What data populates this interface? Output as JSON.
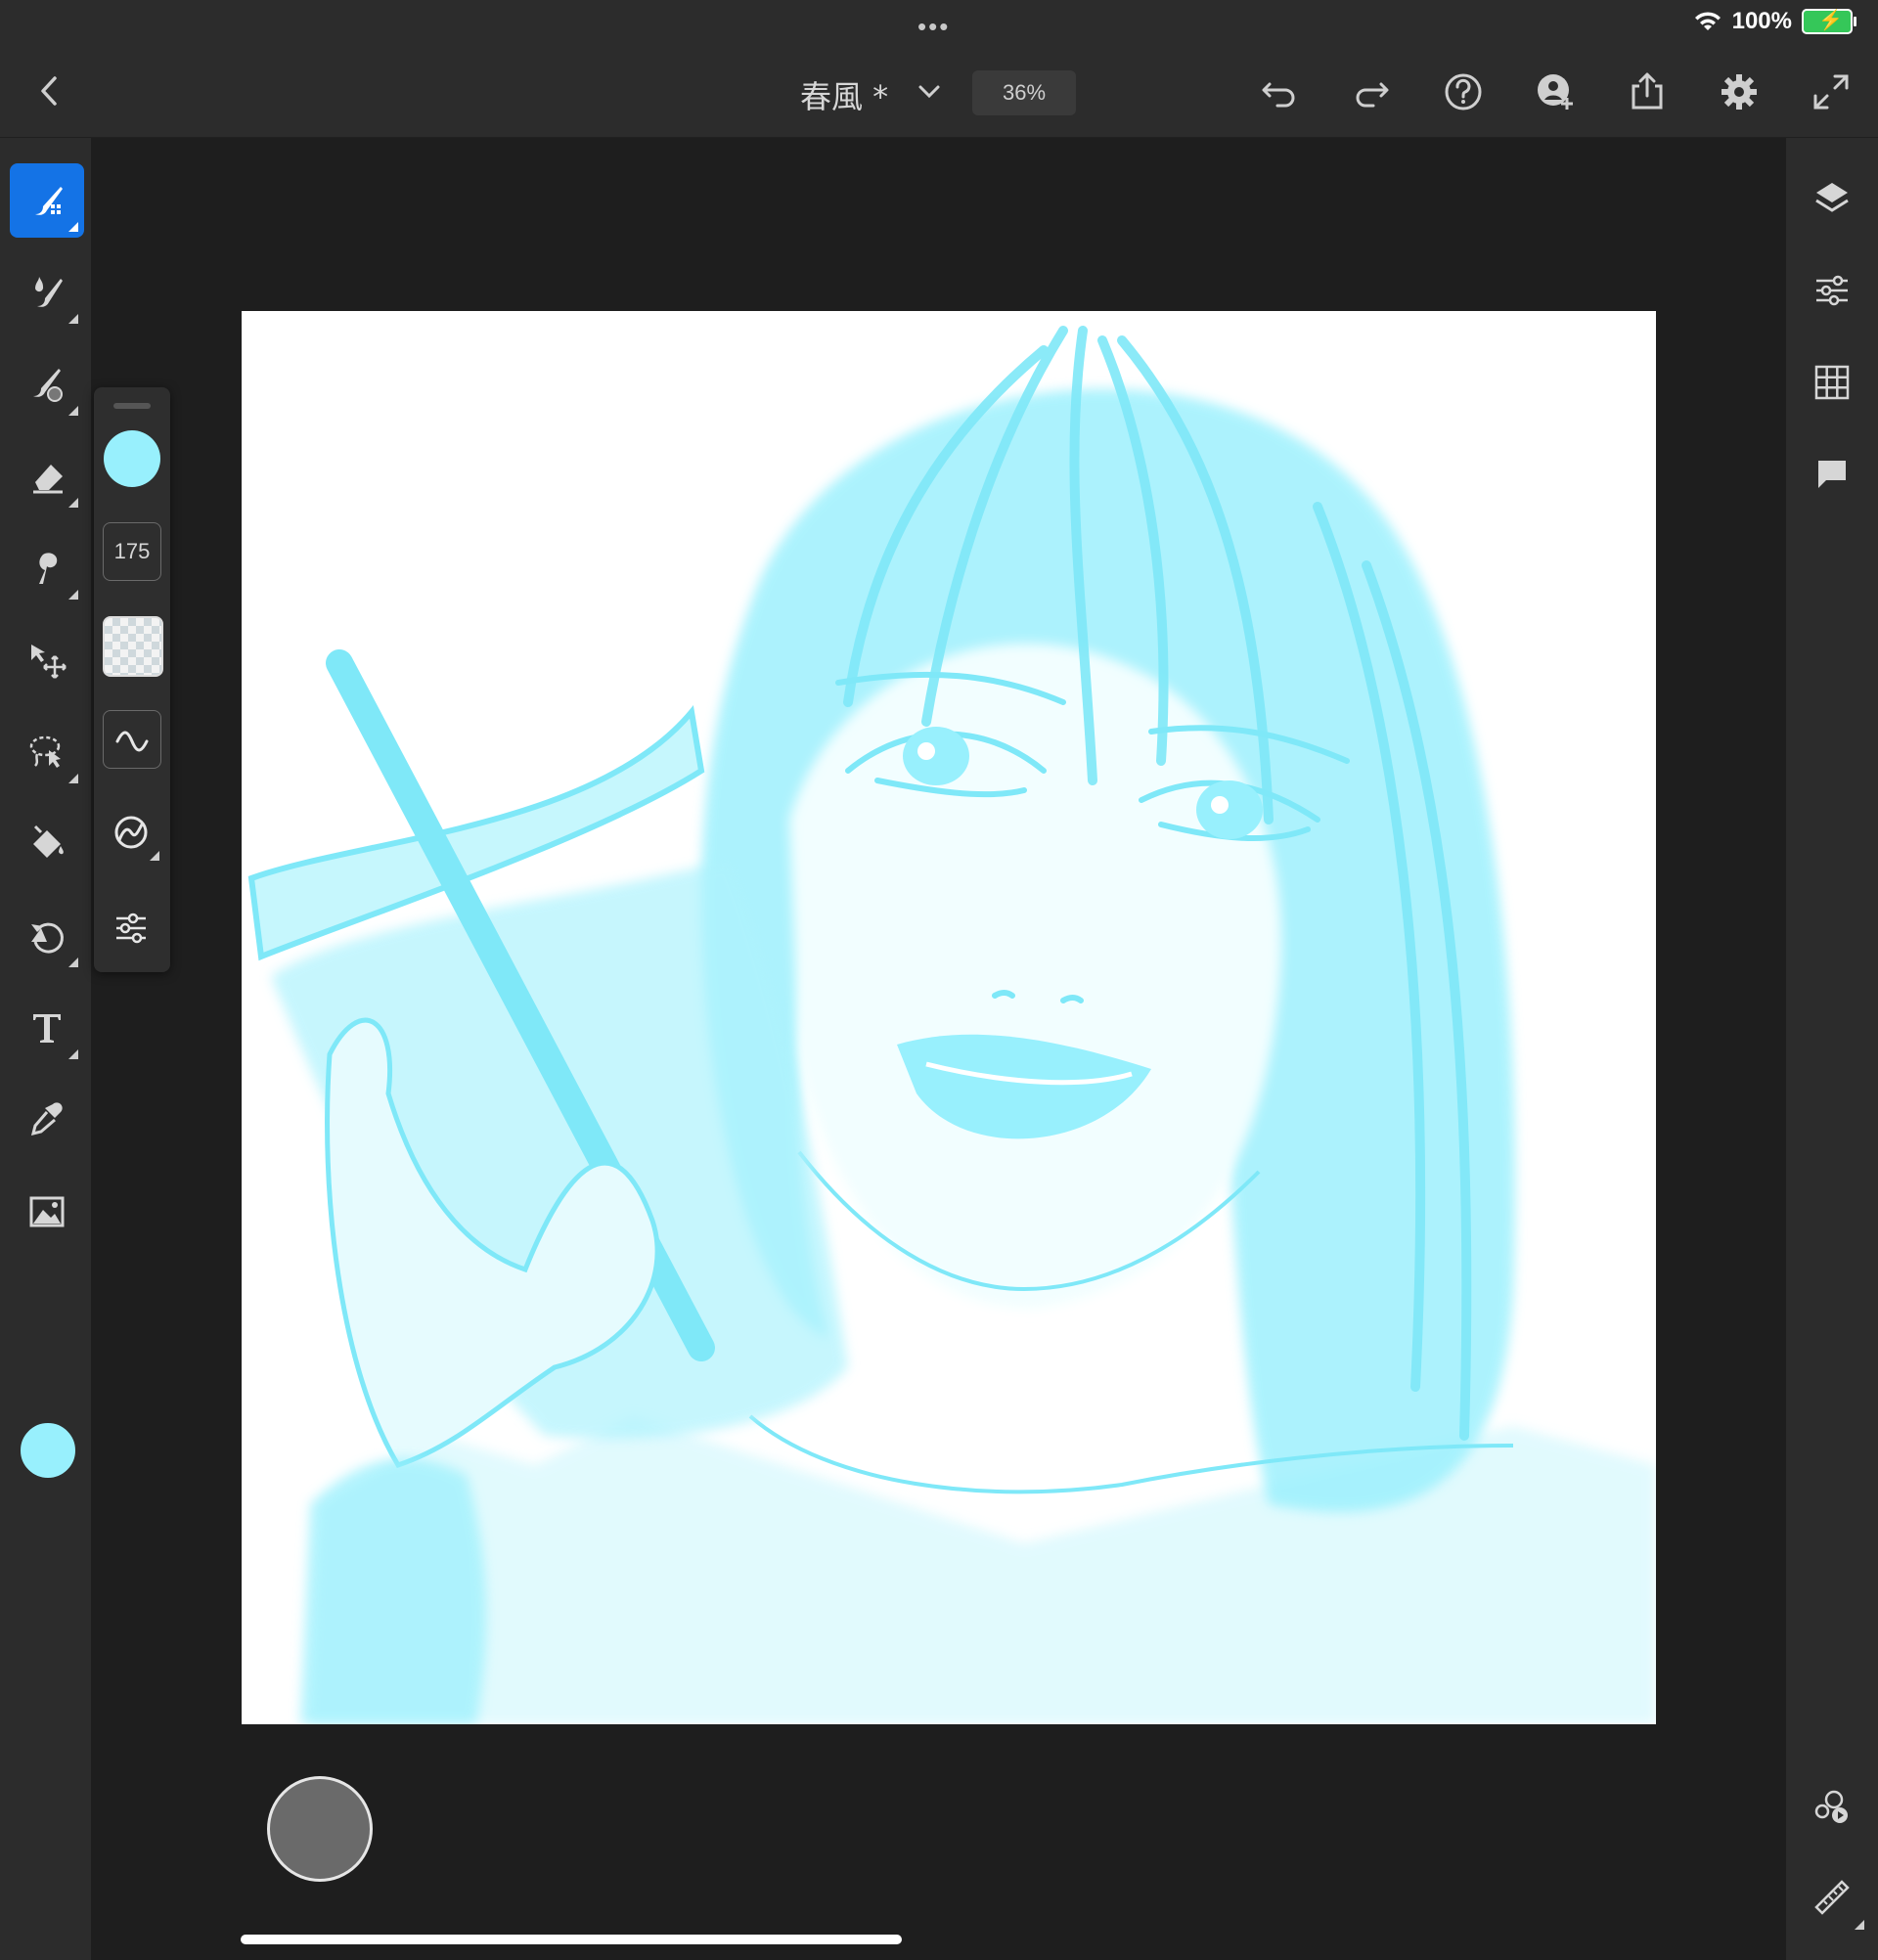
{
  "status": {
    "dots": "•••",
    "battery_text": "100%"
  },
  "toolbar": {
    "document_title": "春風 *",
    "zoom": "36%",
    "icons": [
      "back-icon",
      "chevron-down-icon",
      "undo-icon",
      "redo-icon",
      "help-icon",
      "invite-icon",
      "share-icon",
      "settings-icon",
      "fullscreen-icon"
    ]
  },
  "left_tools": [
    "brush-tool",
    "smudge-tool",
    "mixer-brush-tool",
    "eraser-tool",
    "liquify-tool",
    "transform-tool",
    "lasso-tool",
    "fill-tool",
    "history-tool",
    "type-tool",
    "eyedropper-tool",
    "image-tool"
  ],
  "brush_flyout": {
    "size": "175",
    "color": "#98f0fd",
    "items": [
      "color",
      "size",
      "opacity",
      "smoothing",
      "pressure",
      "brush-settings"
    ]
  },
  "right_tools": [
    "layers-icon",
    "adjustments-icon",
    "grid-icon",
    "comments-icon",
    "livestream-icon",
    "ruler-icon"
  ],
  "colors": {
    "accent": "#1473e6",
    "brush_color": "#98f0fd",
    "panel": "#2c2c2c",
    "workspace": "#1e1e1e"
  }
}
